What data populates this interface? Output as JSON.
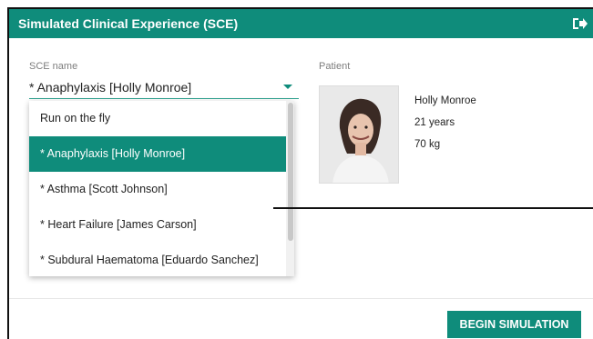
{
  "app": {
    "title": "Simulated Clinical Experience (SCE)",
    "exit_icon": "sign-out-icon",
    "accent_color": "#0f8c7b"
  },
  "sce": {
    "label": "SCE name",
    "selected_value": "* Anaphylaxis [Holly Monroe]",
    "options": [
      {
        "label": "Run on the fly",
        "selected": false
      },
      {
        "label": "* Anaphylaxis [Holly Monroe]",
        "selected": true
      },
      {
        "label": "* Asthma [Scott Johnson]",
        "selected": false
      },
      {
        "label": "* Heart Failure [James Carson]",
        "selected": false
      },
      {
        "label": "* Subdural Haematoma [Eduardo Sanchez]",
        "selected": false
      }
    ]
  },
  "patient": {
    "label": "Patient",
    "name": "Holly Monroe",
    "age": "21 years",
    "weight": "70 kg"
  },
  "actions": {
    "begin_label": "BEGIN SIMULATION"
  }
}
